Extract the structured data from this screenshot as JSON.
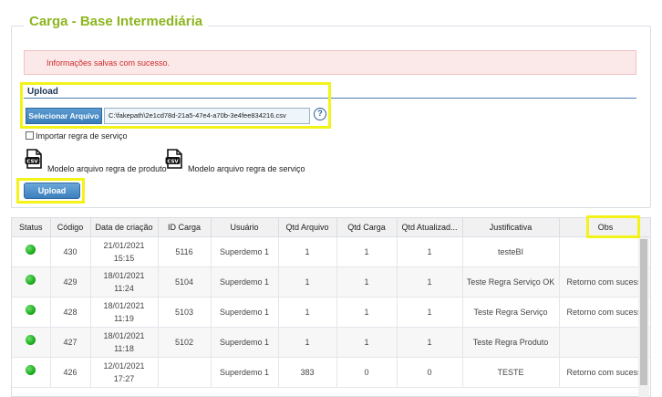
{
  "panel": {
    "title": "Carga - Base Intermediária"
  },
  "alert": {
    "message": "Informações salvas com sucesso."
  },
  "upload": {
    "title": "Upload",
    "select_label": "Selecionar Arquivo",
    "file_value": "C:\\fakepath\\2e1cd78d-21a5-47e4-a70b-3e4fee834216.csv",
    "help_glyph": "?",
    "checkbox_label": "Importar regra de serviço",
    "csv_icon_text": "CSV",
    "model_product_label": "Modelo arquivo regra de produto",
    "model_service_label": "Modelo arquivo regra de serviço",
    "upload_button": "Upload"
  },
  "colors": {
    "title_green": "#8db51f",
    "alert_red": "#cc2b2b",
    "button_blue": "#3b7db9",
    "highlight": "#f3f31a",
    "status_green": "#11a311"
  },
  "table": {
    "headers": [
      "Status",
      "Código",
      "Data de criação",
      "ID Carga",
      "Usuário",
      "Qtd Arquivo",
      "Qtd Carga",
      "Qtd Atualizad...",
      "Justificativa",
      "Obs"
    ],
    "rows": [
      {
        "codigo": "430",
        "date": "21/01/2021",
        "time": "15:15",
        "id": "5116",
        "user": "Superdemo 1",
        "qtd_arquivo": "1",
        "qtd_carga": "1",
        "qtd_atual": "1",
        "justificativa": "testeBI",
        "obs": ""
      },
      {
        "codigo": "429",
        "date": "18/01/2021",
        "time": "11:24",
        "id": "5104",
        "user": "Superdemo 1",
        "qtd_arquivo": "1",
        "qtd_carga": "1",
        "qtd_atual": "1",
        "justificativa": "Teste Regra Serviço OK",
        "obs": "Retorno com sucesso"
      },
      {
        "codigo": "428",
        "date": "18/01/2021",
        "time": "11:19",
        "id": "5103",
        "user": "Superdemo 1",
        "qtd_arquivo": "1",
        "qtd_carga": "1",
        "qtd_atual": "1",
        "justificativa": "Teste Regra Serviço",
        "obs": "Retorno com sucesso"
      },
      {
        "codigo": "427",
        "date": "18/01/2021",
        "time": "11:18",
        "id": "5102",
        "user": "Superdemo 1",
        "qtd_arquivo": "1",
        "qtd_carga": "1",
        "qtd_atual": "1",
        "justificativa": "Teste Regra Produto",
        "obs": ""
      },
      {
        "codigo": "426",
        "date": "12/01/2021",
        "time": "17:27",
        "id": "",
        "user": "Superdemo 1",
        "qtd_arquivo": "383",
        "qtd_carga": "0",
        "qtd_atual": "0",
        "justificativa": "TESTE",
        "obs": "Retorno com sucesso"
      }
    ]
  }
}
